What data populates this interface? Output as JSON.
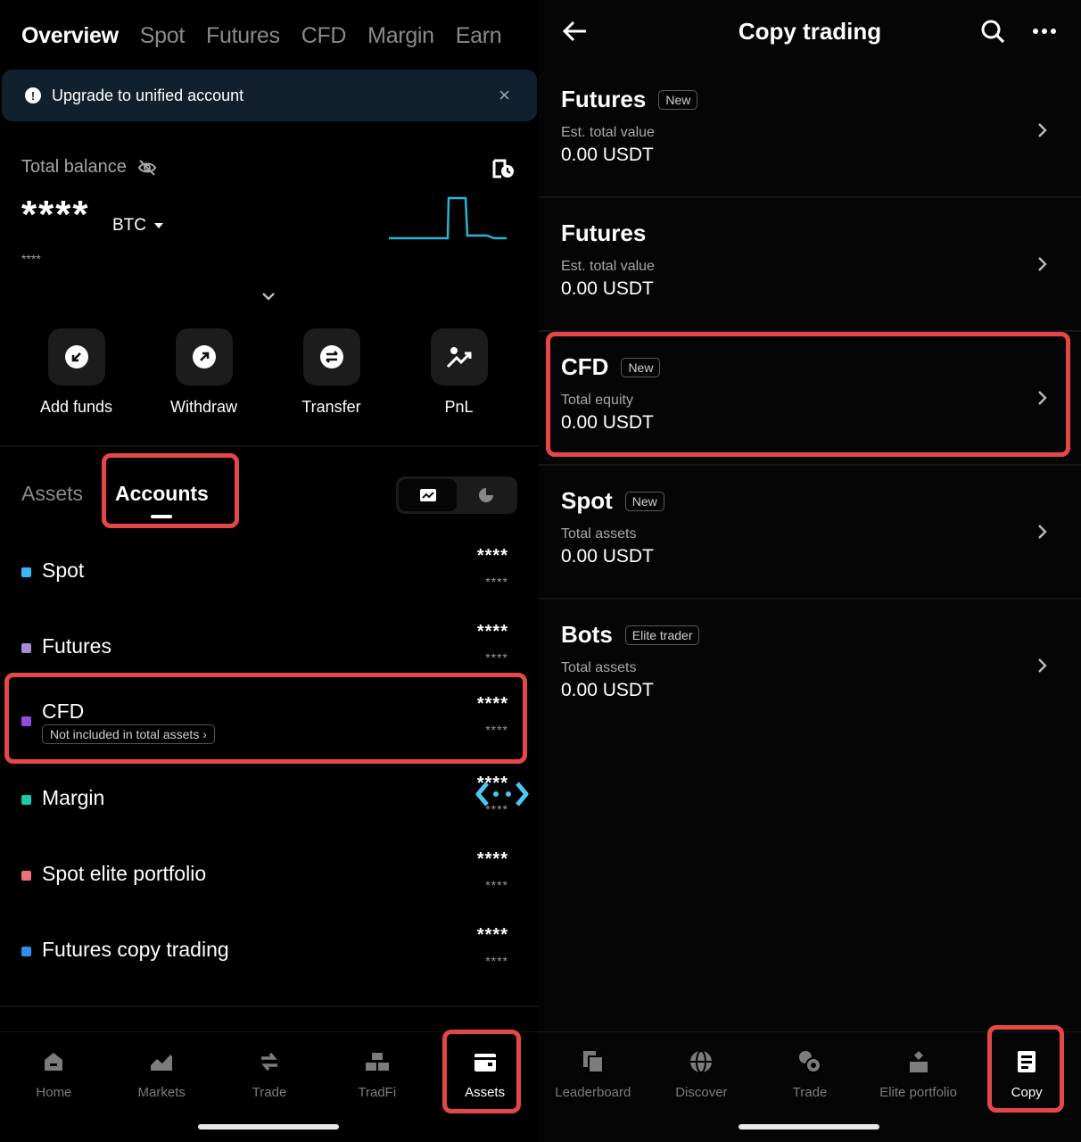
{
  "left": {
    "top_tabs": [
      "Overview",
      "Spot",
      "Futures",
      "CFD",
      "Margin",
      "Earn"
    ],
    "banner": {
      "text": "Upgrade to unified account",
      "close": "×",
      "warn": "!"
    },
    "balance": {
      "label": "Total balance",
      "value": "****",
      "currency": "BTC",
      "sub_value": "****"
    },
    "actions": [
      {
        "label": "Add funds",
        "icon": "add-funds-icon"
      },
      {
        "label": "Withdraw",
        "icon": "withdraw-icon"
      },
      {
        "label": "Transfer",
        "icon": "transfer-icon"
      },
      {
        "label": "PnL",
        "icon": "pnl-icon"
      }
    ],
    "sub_tabs": [
      "Assets",
      "Accounts"
    ],
    "accounts": [
      {
        "name": "Spot",
        "value": "****",
        "sub_value": "****",
        "color": "#3ab8f5"
      },
      {
        "name": "Futures",
        "value": "****",
        "sub_value": "****",
        "color": "#a98bd8"
      },
      {
        "name": "CFD",
        "value": "****",
        "sub_value": "****",
        "color": "#8f4de0",
        "note": "Not included in total assets ›"
      },
      {
        "name": "Margin",
        "value": "****",
        "sub_value": "****",
        "color": "#1ec8a5"
      },
      {
        "name": "Spot elite portfolio",
        "value": "****",
        "sub_value": "****",
        "color": "#f0707a"
      },
      {
        "name": "Futures copy trading",
        "value": "****",
        "sub_value": "****",
        "color": "#2b8ff0"
      }
    ],
    "bottom_nav": [
      {
        "label": "Home",
        "icon": "home-icon"
      },
      {
        "label": "Markets",
        "icon": "markets-icon"
      },
      {
        "label": "Trade",
        "icon": "trade-icon"
      },
      {
        "label": "TradFi",
        "icon": "tradfi-icon"
      },
      {
        "label": "Assets",
        "icon": "assets-icon",
        "active": true
      }
    ]
  },
  "right": {
    "title": "Copy trading",
    "cards": [
      {
        "title": "Futures",
        "tag": "New",
        "label": "Est. total value",
        "value": "0.00 USDT"
      },
      {
        "title": "Futures",
        "tag": "",
        "label": "Est. total value",
        "value": "0.00 USDT"
      },
      {
        "title": "CFD",
        "tag": "New",
        "label": "Total equity",
        "value": "0.00 USDT"
      },
      {
        "title": "Spot",
        "tag": "New",
        "label": "Total assets",
        "value": "0.00 USDT"
      },
      {
        "title": "Bots",
        "tag": "Elite trader",
        "label": "Total assets",
        "value": "0.00 USDT"
      }
    ],
    "bottom_nav": [
      {
        "label": "Leaderboard",
        "icon": "leaderboard-icon"
      },
      {
        "label": "Discover",
        "icon": "discover-icon"
      },
      {
        "label": "Trade",
        "icon": "trade-icon"
      },
      {
        "label": "Elite portfolio",
        "icon": "elite-portfolio-icon"
      },
      {
        "label": "Copy",
        "icon": "copy-icon",
        "active": true
      }
    ]
  },
  "colors": {
    "highlight": "#e54747",
    "banner_bg": "#11202e",
    "sparkline": "#2ab3d6"
  }
}
